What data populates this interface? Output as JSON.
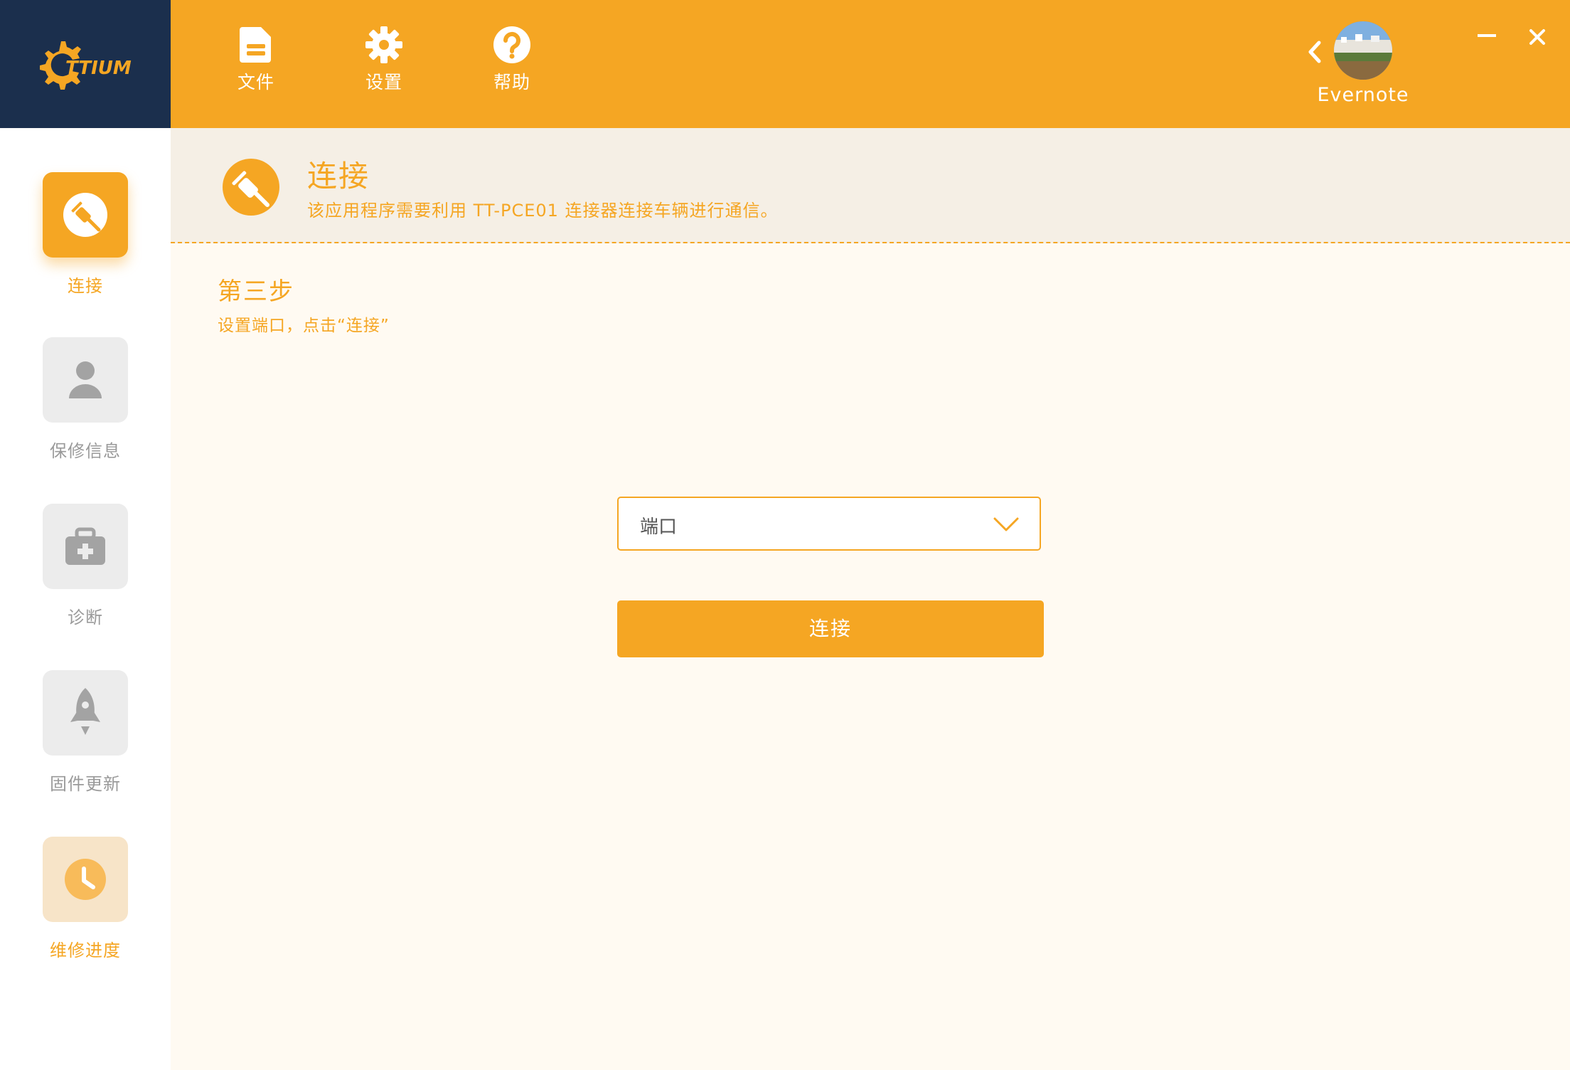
{
  "brand": {
    "logo_text": "TTIUM"
  },
  "toolbar": {
    "items": [
      {
        "label": "文件",
        "icon": "file-icon"
      },
      {
        "label": "设置",
        "icon": "gear-icon"
      },
      {
        "label": "帮助",
        "icon": "help-icon"
      }
    ]
  },
  "user": {
    "name": "Evernote"
  },
  "sidebar": {
    "items": [
      {
        "label": "连接",
        "icon": "plug-icon",
        "state": "active"
      },
      {
        "label": "保修信息",
        "icon": "user-icon",
        "state": "default"
      },
      {
        "label": "诊断",
        "icon": "medkit-icon",
        "state": "default"
      },
      {
        "label": "固件更新",
        "icon": "rocket-icon",
        "state": "default"
      },
      {
        "label": "维修进度",
        "icon": "clock-icon",
        "state": "highlight"
      }
    ]
  },
  "banner": {
    "title": "连接",
    "description": "该应用程序需要利用 TT-PCE01 连接器连接车辆进行通信。"
  },
  "step": {
    "title": "第三步",
    "description": "设置端口，点击“连接”"
  },
  "port_select": {
    "placeholder": "端口"
  },
  "connect_button": {
    "label": "连接"
  },
  "colors": {
    "accent": "#f5a623",
    "logo_bg": "#1b2f4d",
    "banner_bg": "#f5efe5",
    "main_bg": "#fffaf2"
  }
}
